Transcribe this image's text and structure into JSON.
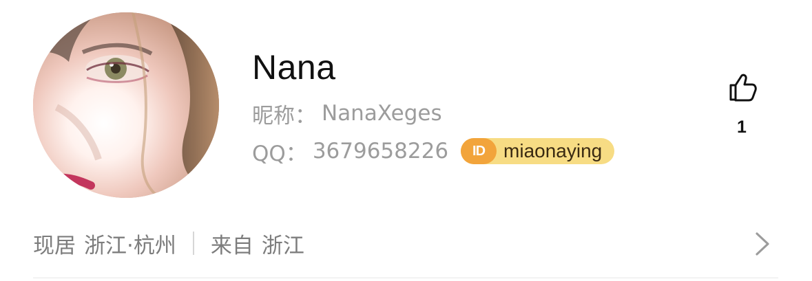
{
  "profile": {
    "name": "Nana",
    "nickname_label": "昵称：",
    "nickname": "NanaXeges",
    "qq_label": "QQ：",
    "qq_number": "3679658226",
    "id_badge_icon": "ID",
    "id_handle": "miaonaying",
    "avatar_icon": "avatar-photo"
  },
  "likes": {
    "icon": "thumbs-up-icon",
    "count": "1"
  },
  "location": {
    "current_label": "现居",
    "current_value": "浙江·杭州",
    "from_label": "来自",
    "from_value": "浙江",
    "chevron_icon": "chevron-right-icon"
  },
  "colors": {
    "text_primary": "#111111",
    "text_secondary": "#9c9c9c",
    "text_location": "#7d7d7d",
    "badge_bg": "#f7dc84",
    "badge_icon_bg": "#f2a43b",
    "divider": "#e8e8e8"
  }
}
